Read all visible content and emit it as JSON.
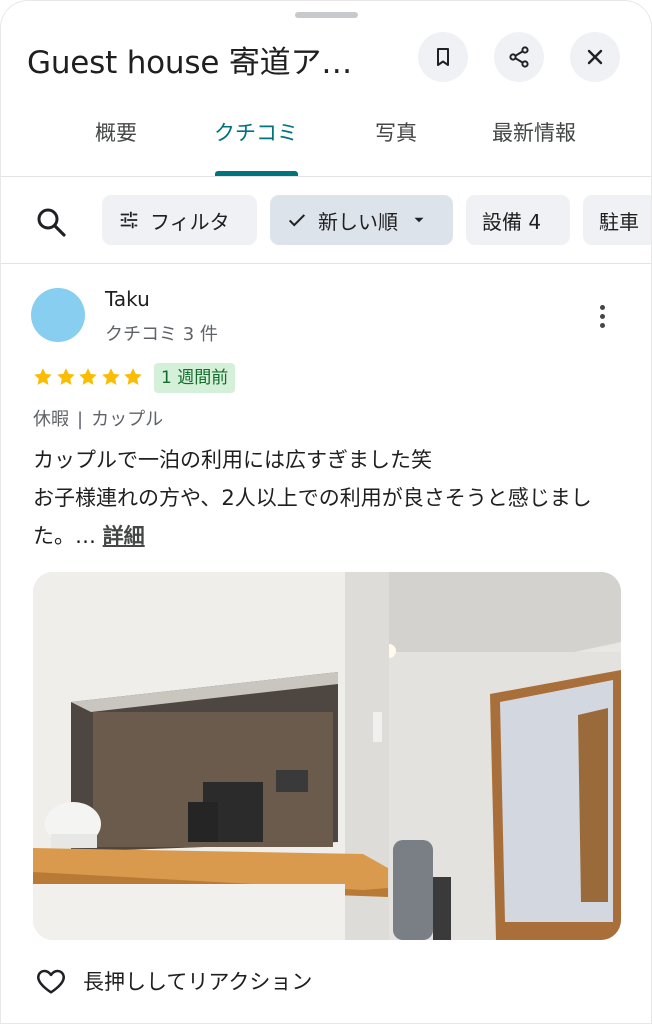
{
  "header": {
    "title": "Guest house 寄道ア…",
    "save_icon": "bookmark-icon",
    "share_icon": "share-icon",
    "close_icon": "close-icon"
  },
  "tabs": [
    {
      "label": "概要"
    },
    {
      "label": "クチコミ"
    },
    {
      "label": "写真"
    },
    {
      "label": "最新情報"
    }
  ],
  "filters": {
    "search_icon": "search-icon",
    "filter_label": "フィルタ",
    "sort_label": "新しい順",
    "facility_label": "設備 4",
    "parking_label": "駐車"
  },
  "review": {
    "author": "Taku",
    "author_sub": "クチコミ 3 件",
    "rating": 5,
    "time_badge": "1 週間前",
    "tag1": "休暇",
    "tag_separator": "|",
    "tag2": "カップル",
    "line1": "カップルで一泊の利用には広すぎました笑",
    "line2": "お子様連れの方や、2人以上での利用が良さそうと感じました。…",
    "more_link": "詳細",
    "reaction_label": "長押ししてリアクション"
  },
  "colors": {
    "accent": "#00747c",
    "star": "#fbbc04",
    "badge_bg": "#d5f0d8",
    "avatar": "#87cef0"
  }
}
